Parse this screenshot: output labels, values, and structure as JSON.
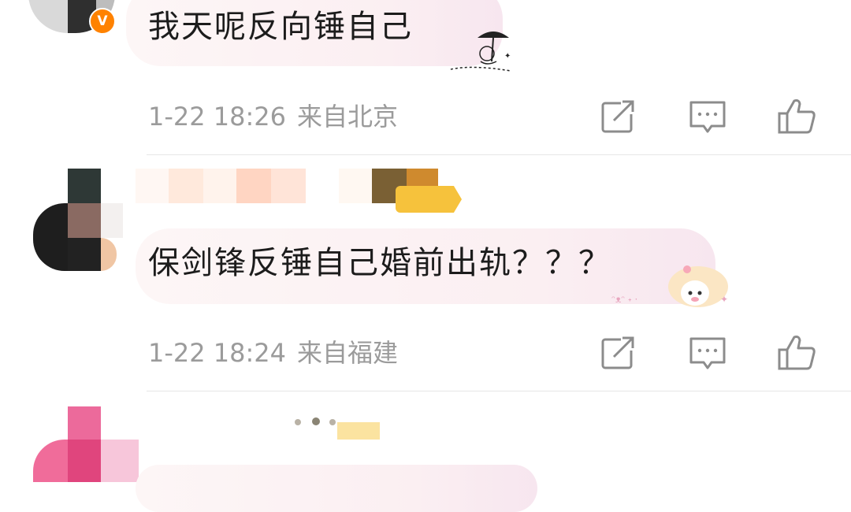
{
  "comments": [
    {
      "text": "我天呢反向锤自己",
      "time": "1-22 18:26",
      "location": "来自北京",
      "verified_badge": "V"
    },
    {
      "text": "保剑锋反锤自己婚前出轨？？？",
      "time": "1-22 18:24",
      "location": "来自福建"
    }
  ],
  "icons": {
    "repost": "share-icon",
    "comment": "comment-icon",
    "like": "thumbs-up-icon"
  },
  "colors": {
    "meta_text": "#9b9b9b",
    "badge": "#ff8200",
    "bubble": "#fbeff2"
  }
}
